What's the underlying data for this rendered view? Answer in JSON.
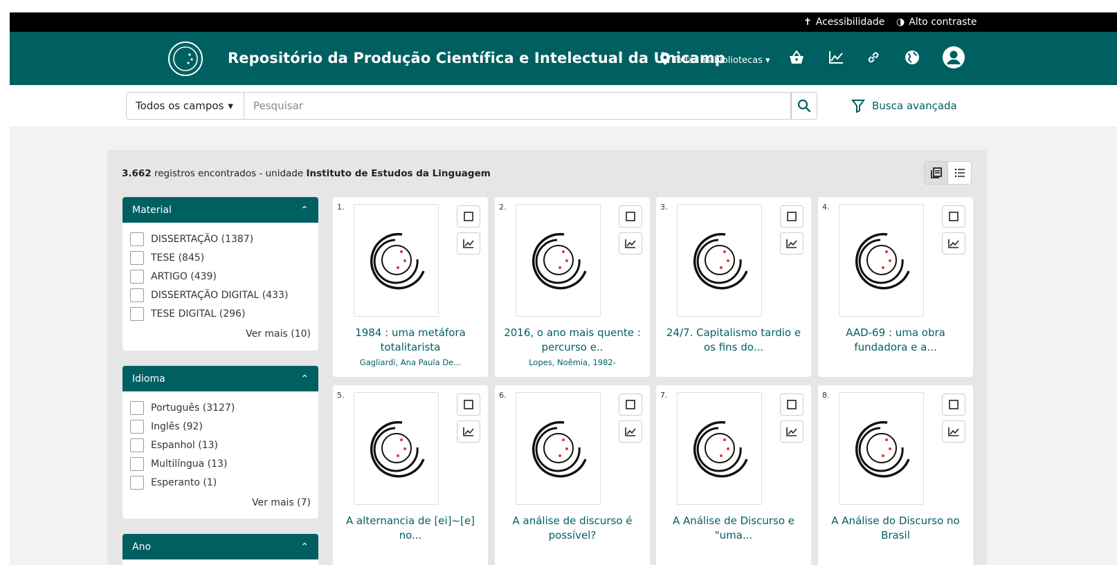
{
  "topbar": {
    "accessibility": "Acessibilidade",
    "contrast": "Alto contraste"
  },
  "header": {
    "title": "Repositório da Produção Científica e Intelectual da Unicamp",
    "libraries": "Todas as bibliotecas",
    "icons": [
      "basket-icon",
      "chart-icon",
      "link-icon",
      "globe-icon",
      "user-icon"
    ]
  },
  "search": {
    "field": "Todos os campos",
    "placeholder": "Pesquisar",
    "advanced": "Busca avançada"
  },
  "results": {
    "count": "3.662",
    "text": "registros encontrados - unidade",
    "unit": "Instituto de Estudos da Linguagem"
  },
  "facets": [
    {
      "title": "Material",
      "items": [
        "DISSERTAÇÃO (1387)",
        "TESE (845)",
        "ARTIGO (439)",
        "DISSERTAÇÃO DIGITAL (433)",
        "TESE DIGITAL (296)"
      ],
      "more": "Ver mais (10)"
    },
    {
      "title": "Idioma",
      "items": [
        "Português (3127)",
        "Inglês (92)",
        "Espanhol (13)",
        "Multilíngua (13)",
        "Esperanto (1)"
      ],
      "more": "Ver mais (7)"
    },
    {
      "title": "Ano"
    }
  ],
  "cards": [
    {
      "num": "1.",
      "title": "1984 : uma metáfora totalitarista",
      "author": "Gagliardi, Ana Paula De..."
    },
    {
      "num": "2.",
      "title": "2016, o ano mais quente : percurso e..",
      "author": "Lopes, Noêmia, 1982-"
    },
    {
      "num": "3.",
      "title": "24/7. Capitalismo tardio e os fins do...",
      "author": ""
    },
    {
      "num": "4.",
      "title": "AAD-69 : uma obra fundadora e a...",
      "author": ""
    },
    {
      "num": "5.",
      "title": "A alternancia de [ei]~[e] no...",
      "author": ""
    },
    {
      "num": "6.",
      "title": "A análise de discurso é possível?",
      "author": ""
    },
    {
      "num": "7.",
      "title": "A Análise de Discurso e \"uma...",
      "author": ""
    },
    {
      "num": "8.",
      "title": "A Análise do Discurso no Brasil",
      "author": ""
    }
  ],
  "colors": {
    "primary": "#005f60",
    "topbar": "#000000",
    "accent_dots": "#e53935"
  }
}
